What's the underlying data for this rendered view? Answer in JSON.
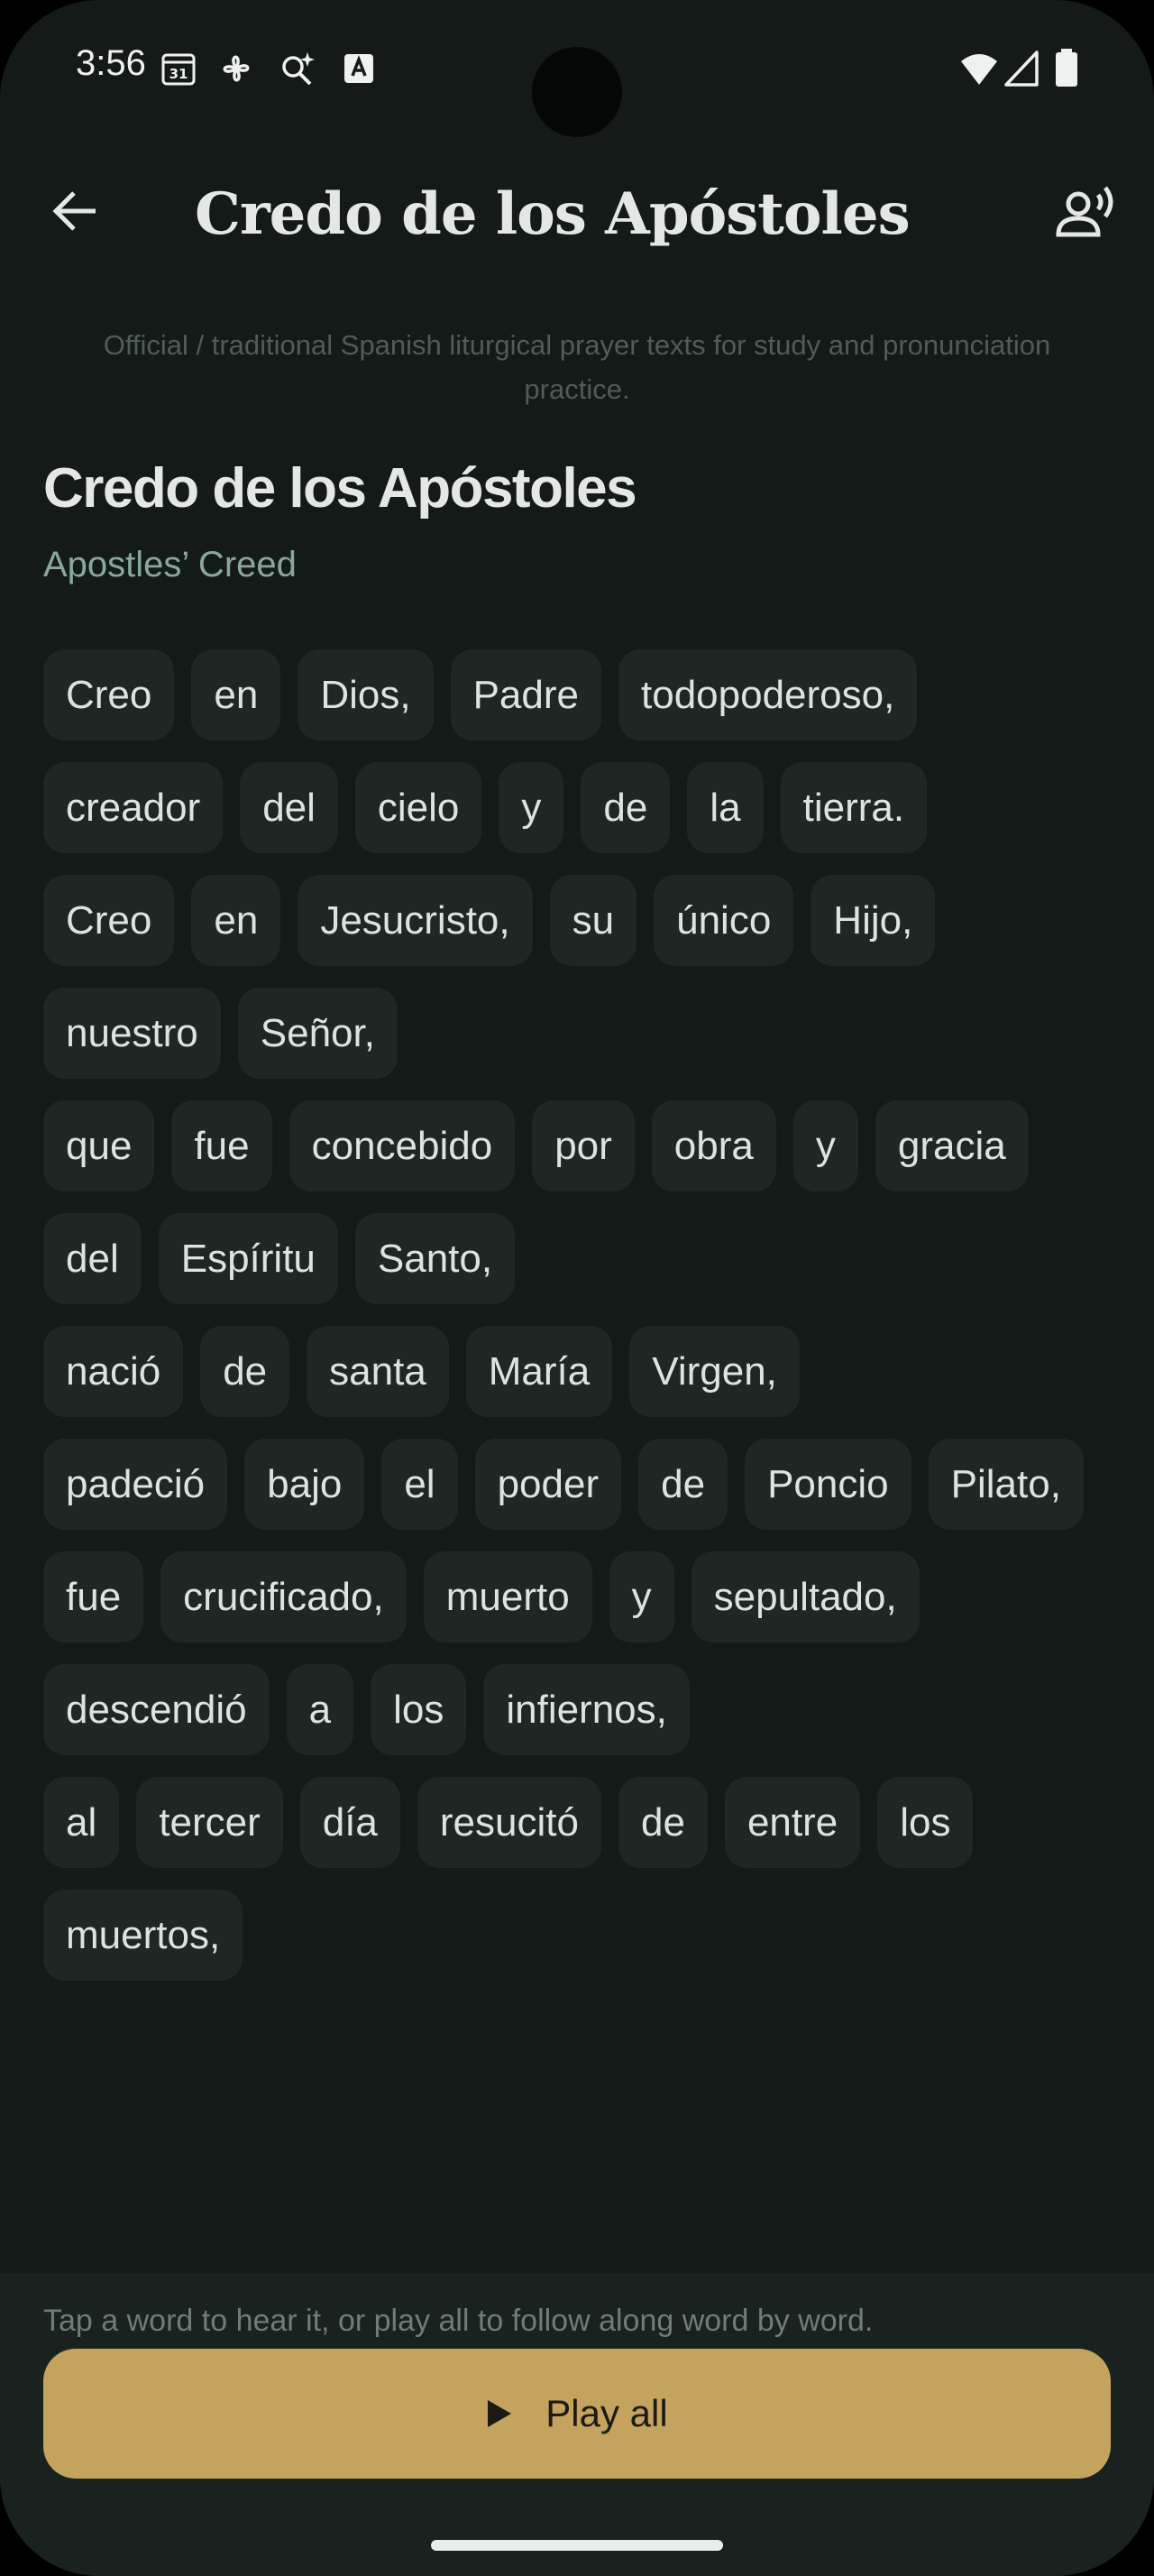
{
  "status_bar": {
    "time": "3:56",
    "calendar_badge": "31",
    "icons": [
      "calendar-icon",
      "pinwheel-icon",
      "sparkle-search-icon",
      "translate-icon",
      "wifi-icon",
      "signal-icon",
      "battery-icon"
    ]
  },
  "app_bar": {
    "title": "Credo de los Apóstoles",
    "back_icon": "arrow-back-icon",
    "voice_icon": "voice-speaker-icon"
  },
  "subtitle": "Official / traditional Spanish liturgical prayer texts for study and pronunciation practice.",
  "prayer": {
    "title": "Credo de los Apóstoles",
    "english_title": "Apostles’ Creed"
  },
  "lines": [
    [
      "Creo",
      "en",
      "Dios,",
      "Padre",
      "todopoderoso,"
    ],
    [
      "creador",
      "del",
      "cielo",
      "y",
      "de",
      "la",
      "tierra."
    ],
    [
      "Creo",
      "en",
      "Jesucristo,",
      "su",
      "único",
      "Hijo,",
      "nuestro",
      "Señor,"
    ],
    [
      "que",
      "fue",
      "concebido",
      "por",
      "obra",
      "y",
      "gracia",
      "del",
      "Espíritu",
      "Santo,"
    ],
    [
      "nació",
      "de",
      "santa",
      "María",
      "Virgen,"
    ],
    [
      "padeció",
      "bajo",
      "el",
      "poder",
      "de",
      "Poncio",
      "Pilato,"
    ],
    [
      "fue",
      "crucificado,",
      "muerto",
      "y",
      "sepultado,"
    ],
    [
      "descendió",
      "a",
      "los",
      "infiernos,"
    ],
    [
      "al",
      "tercer",
      "día",
      "resucitó",
      "de",
      "entre",
      "los",
      "muertos,"
    ]
  ],
  "footer": {
    "hint": "Tap a word to hear it, or play all to follow along word by word.",
    "play_label": "Play all"
  },
  "colors": {
    "background": "#131a18",
    "chip": "#1f2725",
    "accent": "#c3a35e",
    "subtitle_green": "#8aa79d"
  }
}
